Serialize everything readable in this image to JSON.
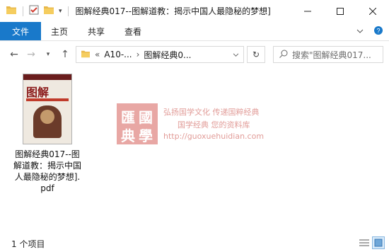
{
  "window": {
    "title": "图解经典017--图解道教：揭示中国人最隐秘的梦想]"
  },
  "ribbon": {
    "file_tab": "文件",
    "tabs": [
      "主页",
      "共享",
      "查看"
    ]
  },
  "address": {
    "overflow": "«",
    "crumbs": [
      "A10-...",
      "图解经典0..."
    ]
  },
  "search": {
    "placeholder": "搜索\"图解经典017..."
  },
  "files": [
    {
      "name": "图解经典017--图解道教：揭示中国人最隐秘的梦想].pdf",
      "thumb_title": "图解"
    }
  ],
  "watermark": {
    "seal_chars": [
      "匯",
      "國",
      "典",
      "學"
    ],
    "line1": "弘扬国学文化  传递国粹经典",
    "line2": "国学经典  您的资料库",
    "url": "http://guoxuehuidian.com"
  },
  "status": {
    "item_count": "1 个项目"
  },
  "colors": {
    "accent": "#1979ca",
    "watermark": "#c94a43"
  }
}
